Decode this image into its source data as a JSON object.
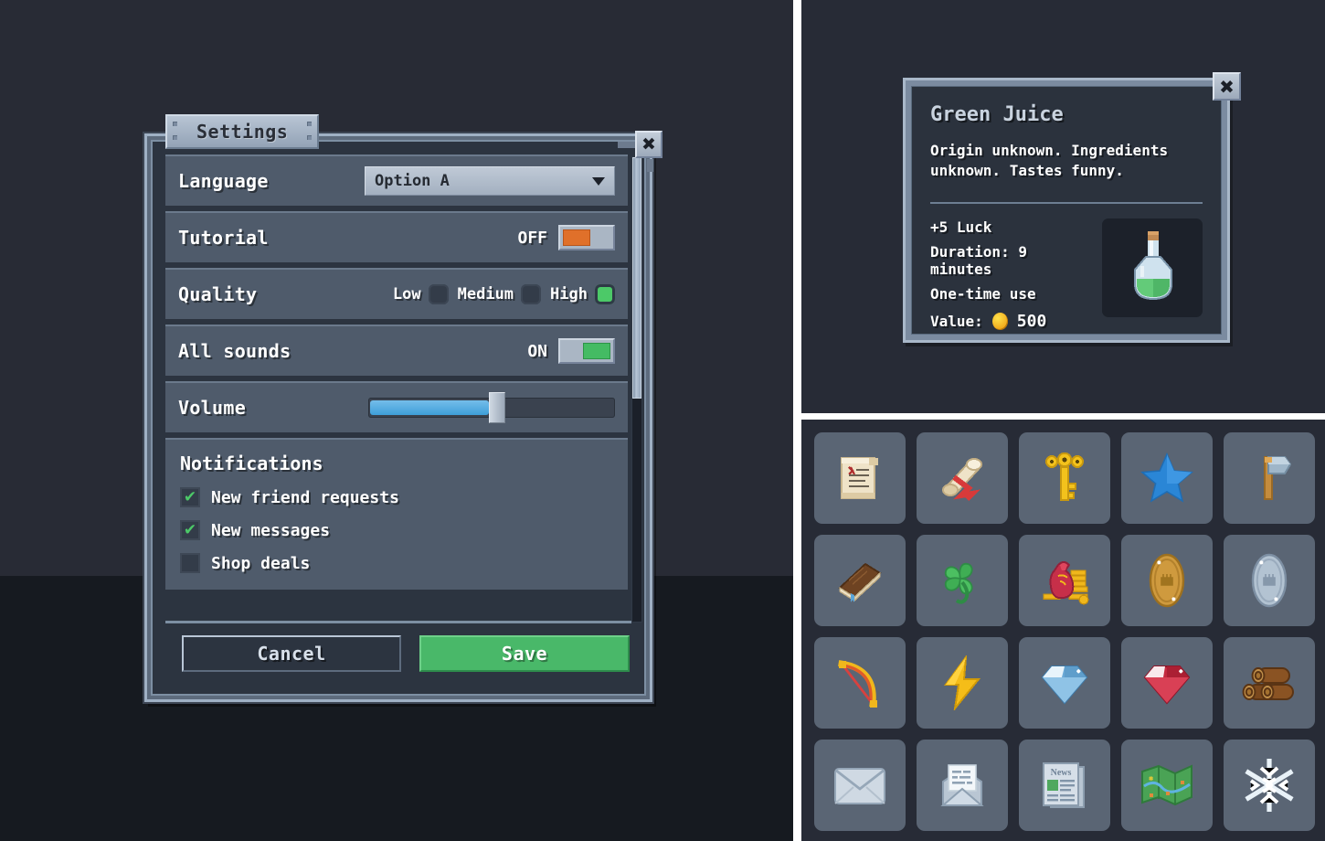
{
  "scene": {
    "bg_top_color": "#282b35",
    "bg_bottom_color": "#161a20"
  },
  "settings_dialog": {
    "tab_title": "Settings",
    "close_icon": "close-x-icon",
    "rows": [
      {
        "label": "Language",
        "control": "dropdown",
        "value": "Option A",
        "caret_icon": "chevron-down-icon"
      },
      {
        "label": "Tutorial",
        "control": "toggle",
        "state_text": "OFF",
        "state": "off",
        "knob_color": "#e0702a"
      },
      {
        "label": "Quality",
        "control": "radio-group",
        "options": [
          {
            "label": "Low",
            "selected": false
          },
          {
            "label": "Medium",
            "selected": false
          },
          {
            "label": "High",
            "selected": true
          }
        ],
        "selected_color": "#4cc968"
      },
      {
        "label": "All sounds",
        "control": "toggle",
        "state_text": "ON",
        "state": "on",
        "knob_color": "#44bb63"
      },
      {
        "label": "Volume",
        "control": "slider",
        "percent": 49,
        "fill_color": "#3e9fd9"
      }
    ],
    "notifications": {
      "title": "Notifications",
      "items": [
        {
          "label": "New friend requests",
          "checked": true
        },
        {
          "label": "New messages",
          "checked": true
        },
        {
          "label": "Shop deals",
          "checked": false
        }
      ],
      "tick_glyph": "✔"
    },
    "footer": {
      "cancel_label": "Cancel",
      "save_label": "Save",
      "save_color": "#49b869"
    },
    "scrollbar": {
      "thumb_percent": 52
    }
  },
  "item_tooltip": {
    "title": "Green Juice",
    "description": "Origin unknown. Ingredients unknown. Tastes funny.",
    "stats": [
      "+5 Luck",
      "Duration: 9 minutes",
      "One-time use"
    ],
    "value_label": "Value:",
    "value_amount": "500",
    "coin_icon": "gold-coin-icon",
    "thumb_icon": "green-potion-flask-icon",
    "close_icon": "close-x-icon"
  },
  "inventory_grid": {
    "cells": [
      {
        "name": "scroll-paper-icon",
        "label": "Scroll"
      },
      {
        "name": "rolled-scroll-icon",
        "label": "Rolled Scroll"
      },
      {
        "name": "gold-key-icon",
        "label": "Key"
      },
      {
        "name": "blue-star-icon",
        "label": "Star"
      },
      {
        "name": "axe-icon",
        "label": "Axe"
      },
      {
        "name": "book-icon",
        "label": "Book"
      },
      {
        "name": "four-leaf-clover-icon",
        "label": "Clover"
      },
      {
        "name": "money-bag-icon",
        "label": "Money Bag"
      },
      {
        "name": "gold-coin-icon",
        "label": "Gold Coin"
      },
      {
        "name": "silver-coin-icon",
        "label": "Silver Coin"
      },
      {
        "name": "bow-icon",
        "label": "Bow"
      },
      {
        "name": "lightning-bolt-icon",
        "label": "Lightning"
      },
      {
        "name": "blue-diamond-icon",
        "label": "Diamond"
      },
      {
        "name": "red-gem-icon",
        "label": "Ruby"
      },
      {
        "name": "wood-logs-icon",
        "label": "Logs"
      },
      {
        "name": "closed-envelope-icon",
        "label": "Mail"
      },
      {
        "name": "open-letter-icon",
        "label": "Letter"
      },
      {
        "name": "newspaper-icon",
        "label": "News"
      },
      {
        "name": "folded-map-icon",
        "label": "Map"
      },
      {
        "name": "snowflake-icon",
        "label": "Snowflake"
      }
    ]
  }
}
